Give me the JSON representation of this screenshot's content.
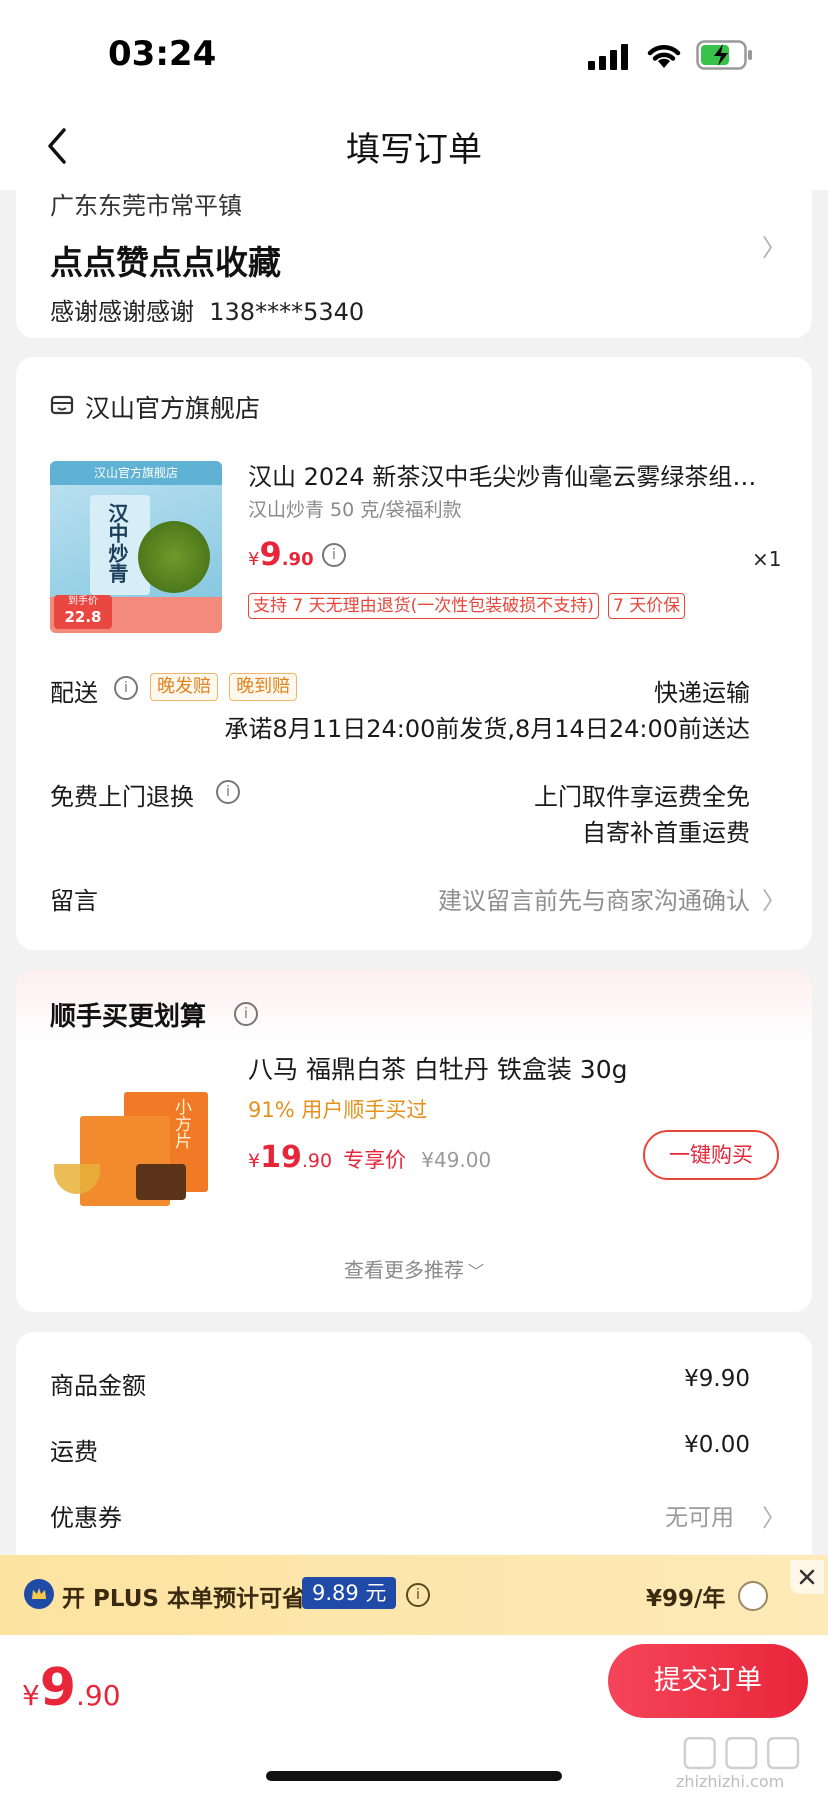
{
  "status": {
    "time": "03:24"
  },
  "nav": {
    "title": "填写订单"
  },
  "address": {
    "region": "广东东莞市常平镇",
    "detail": "点点赞点点收藏",
    "contact": "感谢感谢感谢  138****5340"
  },
  "store": {
    "name": "汉山官方旗舰店",
    "product": {
      "title": "汉山 2024 新茶汉中毛尖炒青仙毫云雾绿茶组…",
      "spec": "汉山炒青 50 克/袋福利款",
      "price_symbol": "¥",
      "price_int": "9",
      "price_dec": ".90",
      "qty": "×1",
      "tags": [
        "支持 7 天无理由退货(一次性包装破损不支持)",
        "7 天价保"
      ],
      "image_texts": {
        "banner": "汉山官方旗舰店",
        "pack": "汉中炒青",
        "badge_label": "到手价",
        "badge_price": "22.8"
      }
    },
    "delivery": {
      "label": "配送",
      "tags": [
        "晚发赔",
        "晚到赔"
      ],
      "method": "快递运输",
      "promise": "承诺8月11日24:00前发货,8月14日24:00前送达"
    },
    "return": {
      "label": "免费上门退换",
      "line1": "上门取件享运费全免",
      "line2": "自寄补首重运费"
    },
    "message": {
      "label": "留言",
      "placeholder": "建议留言前先与商家沟通确认"
    }
  },
  "recommend": {
    "title": "顺手买更划算",
    "item": {
      "name": "八马 福鼎白茶 白牡丹 铁盒装 30g",
      "bought": "91% 用户顺手买过",
      "price_symbol": "¥",
      "price_int": "19",
      "price_dec": ".90",
      "price_tag": "专享价",
      "orig_price": "¥49.00",
      "button": "一键购买",
      "image_text": "小方片"
    },
    "more": "查看更多推荐"
  },
  "summary": {
    "rows": [
      {
        "label": "商品金额",
        "value": "¥9.90"
      },
      {
        "label": "运费",
        "value": "¥0.00"
      },
      {
        "label": "优惠券",
        "value": "无可用"
      }
    ]
  },
  "plus": {
    "text": "开 PLUS 本单预计可省",
    "amount": "9.89 元",
    "price": "¥99/年"
  },
  "footer": {
    "price_symbol": "¥",
    "price_int": "9",
    "price_dec": ".90",
    "submit": "提交订单"
  },
  "watermark": {
    "site": "zhizhizhi.com"
  },
  "colors": {
    "accent": "#e8263a",
    "plus_bar": "#fde5a6",
    "plus_badge": "#1f4aa8"
  }
}
